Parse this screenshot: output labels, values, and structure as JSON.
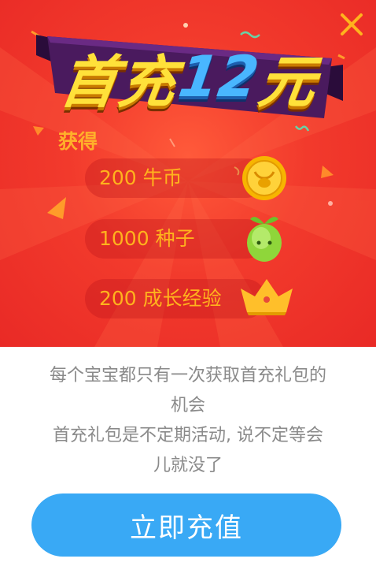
{
  "banner": {
    "title_prefix": "首充",
    "title_amount": "12",
    "title_suffix": "元"
  },
  "close_icon": "close-icon",
  "rewards": {
    "heading": "获得",
    "items": [
      {
        "label": "200 牛币",
        "icon": "coin-icon"
      },
      {
        "label": "1000 种子",
        "icon": "sprout-icon"
      },
      {
        "label": "200 成长经验",
        "icon": "crown-icon"
      }
    ]
  },
  "info": {
    "line1": "每个宝宝都只有一次获取首充礼包的",
    "line2": "机会",
    "line3": "首充礼包是不定期活动, 说不定等会",
    "line4": "儿就没了"
  },
  "cta": {
    "label": "立即充值"
  },
  "colors": {
    "background_red": "#f23a2c",
    "reward_text": "#ffb31d",
    "button_blue": "#39a9f5",
    "info_text": "#8a8a8a"
  }
}
